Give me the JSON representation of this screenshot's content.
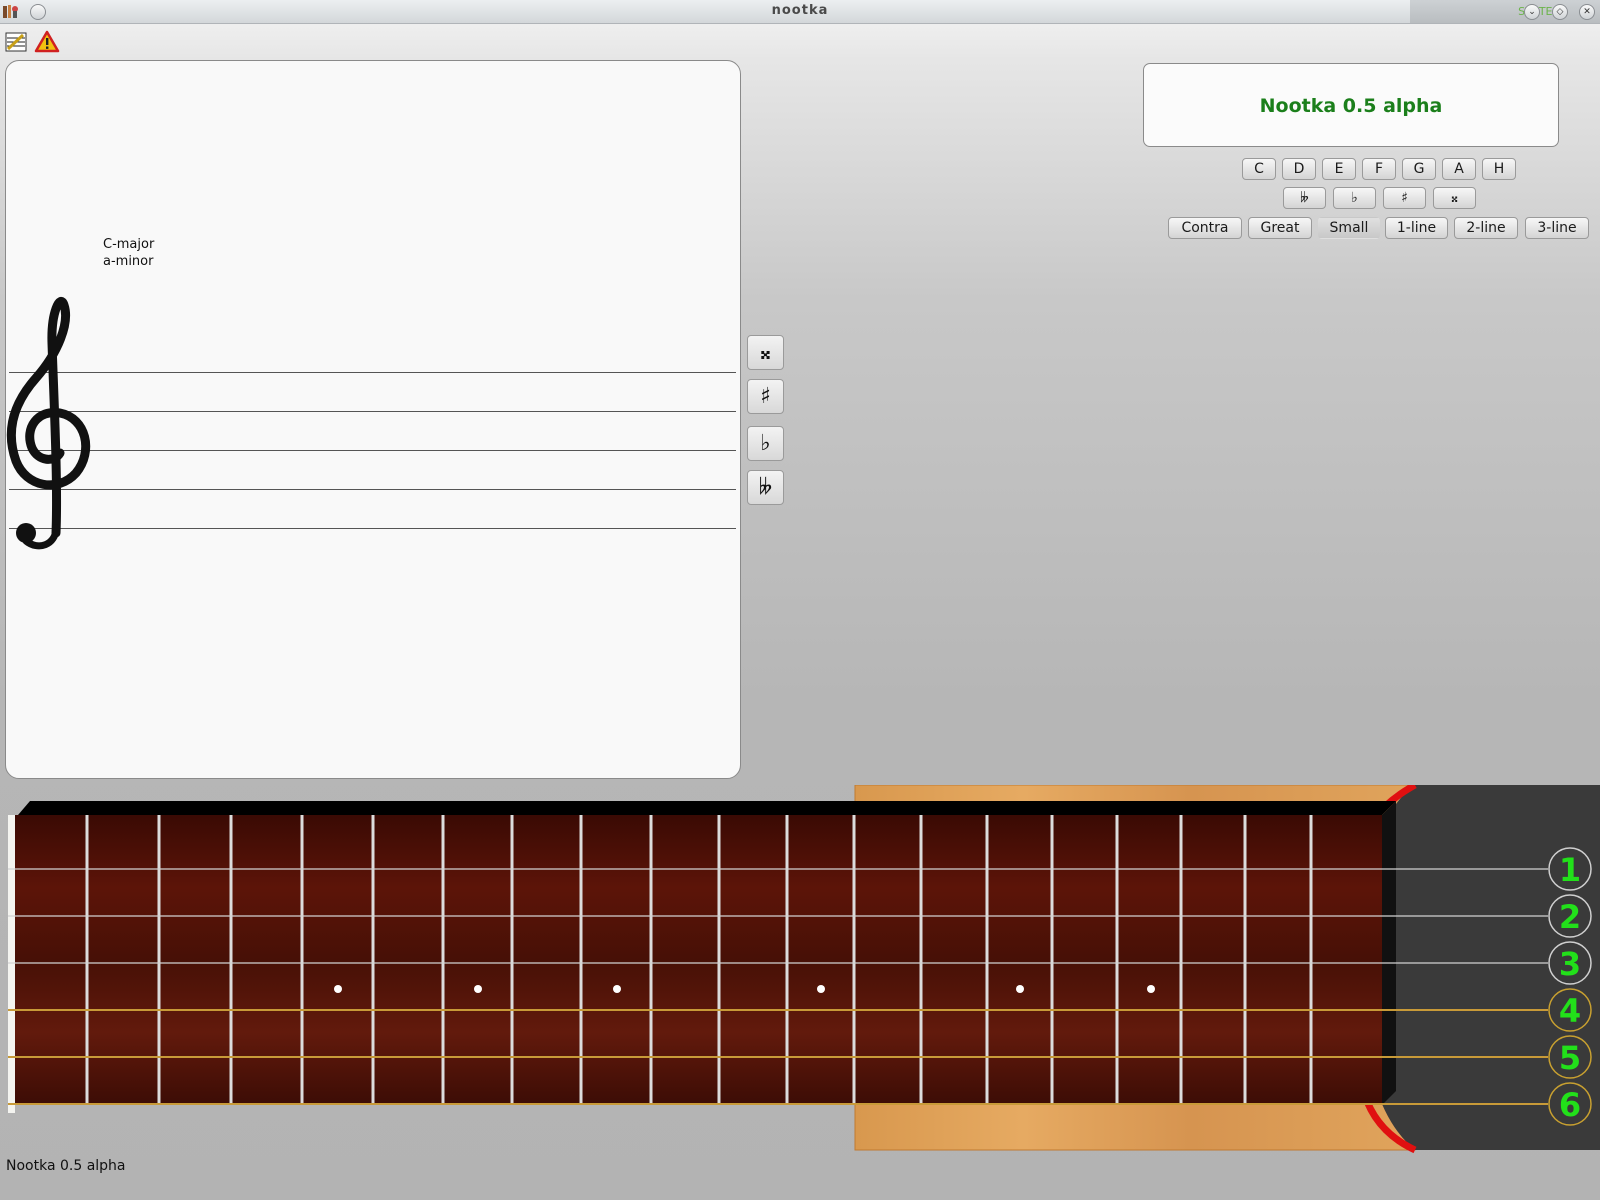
{
  "window": {
    "title": "nootka",
    "system_label": "SYSTEM"
  },
  "score": {
    "key_major": "C-major",
    "key_minor": "a-minor"
  },
  "accidentals": [
    {
      "name": "double-sharp",
      "glyph": "𝄪"
    },
    {
      "name": "sharp",
      "glyph": "♯"
    },
    {
      "name": "flat",
      "glyph": "♭"
    },
    {
      "name": "double-flat",
      "glyph": "𝄫"
    }
  ],
  "note_name": {
    "display": "Nootka 0.5 alpha",
    "notes": [
      "C",
      "D",
      "E",
      "F",
      "G",
      "A",
      "H"
    ],
    "accidentals": [
      "𝄫",
      "♭",
      "♯",
      "𝄪"
    ],
    "octaves": [
      "Contra",
      "Great",
      "Small",
      "1-line",
      "2-line",
      "3-line"
    ],
    "selected_octave": "Small"
  },
  "guitar": {
    "strings": [
      "1",
      "2",
      "3",
      "4",
      "5",
      "6"
    ],
    "string_label_color": "#22e01a",
    "frets": 19
  },
  "status_text": "Nootka 0.5 alpha"
}
